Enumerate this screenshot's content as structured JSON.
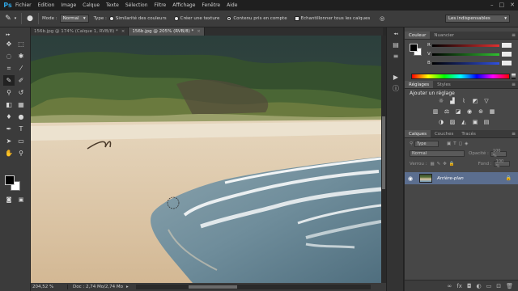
{
  "app": {
    "logo": "Ps",
    "menu": [
      "Fichier",
      "Edition",
      "Image",
      "Calque",
      "Texte",
      "Sélection",
      "Filtre",
      "Affichage",
      "Fenêtre",
      "Aide"
    ],
    "window_controls": [
      "–",
      "□",
      "✕"
    ]
  },
  "options_bar": {
    "mode_label": "Mode :",
    "mode_value": "Normal",
    "type_label": "Type :",
    "sim_label": "Similarité des couleurs",
    "texture_label": "Créer une texture",
    "content_label": "Contenu pris en compte",
    "sample_label": "Echantillonner tous les calques",
    "workspace_value": "Les indispensables"
  },
  "document_tabs": [
    {
      "label": "156b.jpg @ 174% (Calque 1, RVB/8) *",
      "active": false
    },
    {
      "label": "156b.jpg @ 205% (RVB/8) *",
      "active": true
    }
  ],
  "status": {
    "zoom": "204,52 %",
    "doc": "Doc : 2,74 Mo/2,74 Mo"
  },
  "color_panel": {
    "tabs": [
      "Couleur",
      "Nuancier"
    ],
    "channels": [
      {
        "label": "R",
        "color": "#e03030"
      },
      {
        "label": "V",
        "color": "#30c030"
      },
      {
        "label": "B",
        "color": "#3050e0"
      }
    ]
  },
  "adjust_panel": {
    "tabs": [
      "Réglages",
      "Styles"
    ],
    "title": "Ajouter un réglage"
  },
  "layers_panel": {
    "tabs": [
      "Calques",
      "Couches",
      "Tracés"
    ],
    "filter_value": "Type",
    "blend_value": "Normal",
    "opacity_label": "Opacité :",
    "opacity_value": "100 %",
    "lock_label": "Verrou :",
    "fill_label": "Fond :",
    "fill_value": "100 %",
    "layer_name": "Arrière-plan"
  }
}
